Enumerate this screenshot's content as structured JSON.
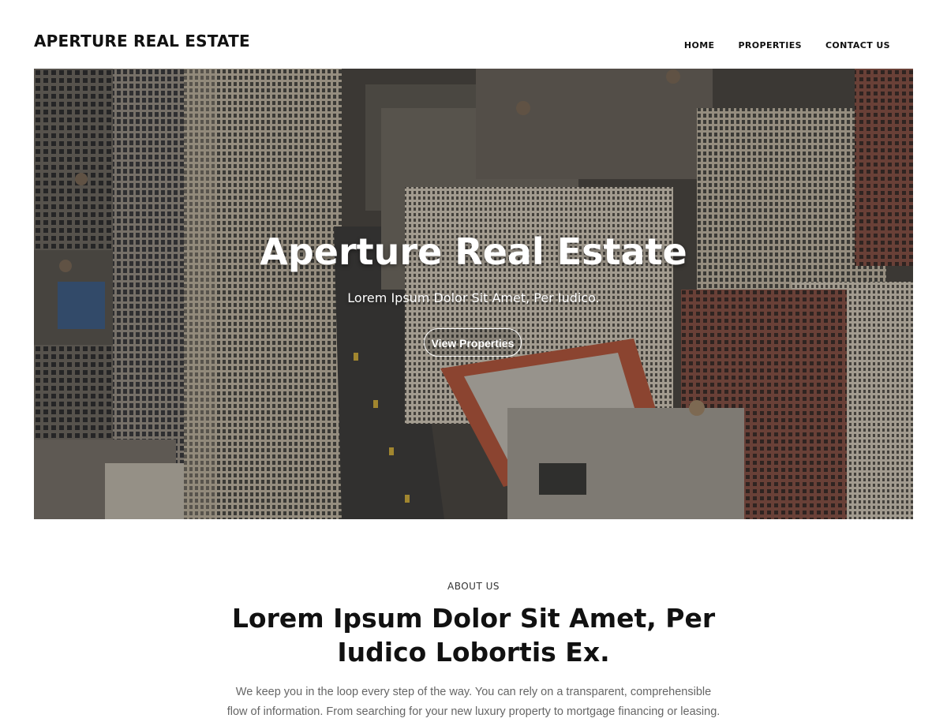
{
  "header": {
    "logo": "APERTURE REAL ESTATE",
    "nav": [
      {
        "label": "HOME"
      },
      {
        "label": "PROPERTIES"
      },
      {
        "label": "CONTACT US"
      }
    ]
  },
  "hero": {
    "image": "aerial city buildings photo",
    "title": "Aperture Real Estate",
    "subtitle": "Lorem Ipsum Dolor Sit Amet, Per Iudico.",
    "button_label": "View Properties"
  },
  "about": {
    "eyebrow": "ABOUT US",
    "heading": "Lorem Ipsum Dolor Sit Amet, Per Iudico Lobortis Ex.",
    "text": "We keep you in the loop every step of the way. You can rely on a transparent, comprehensible flow of information. From searching for your new luxury property to mortgage financing or leasing."
  },
  "colors": {
    "text": "#111111",
    "muted_text": "#666666",
    "background": "#ffffff",
    "hero_text": "#ffffff"
  }
}
